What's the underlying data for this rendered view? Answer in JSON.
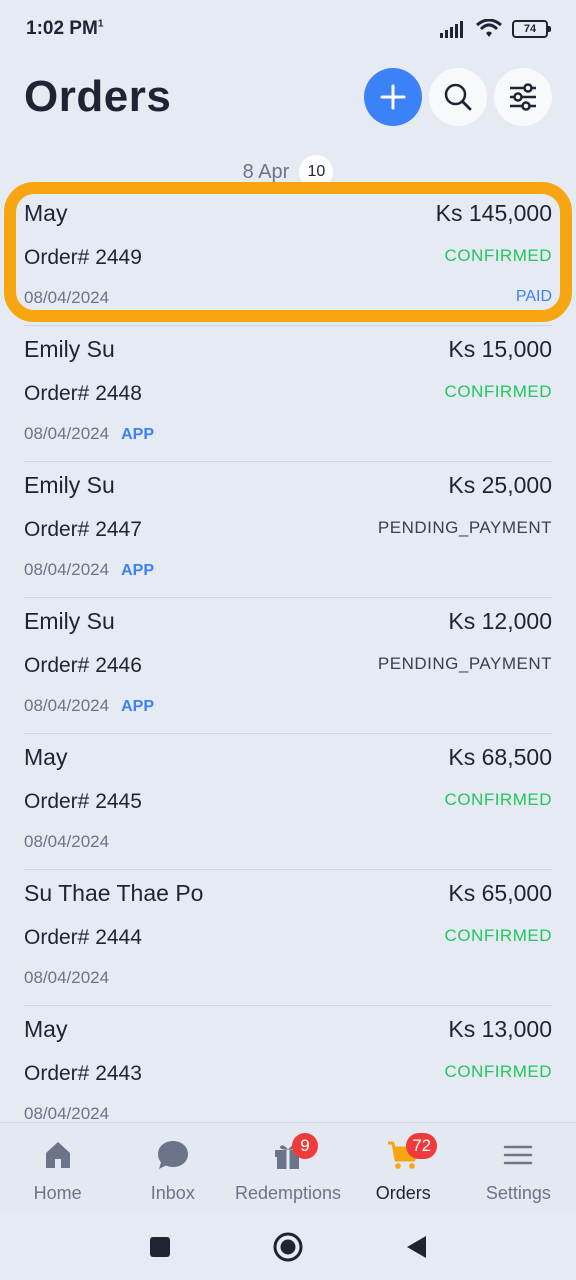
{
  "status_bar": {
    "time": "1:02 PM",
    "time_sup": "1",
    "battery": "74"
  },
  "header": {
    "title": "Orders"
  },
  "date_separator": {
    "label": "8 Apr",
    "count": "10"
  },
  "orders": [
    {
      "name": "May",
      "amount": "Ks 145,000",
      "number": "Order# 2449",
      "status": "CONFIRMED",
      "date": "08/04/2024",
      "source": "",
      "payment": "PAID"
    },
    {
      "name": "Emily Su",
      "amount": "Ks 15,000",
      "number": "Order# 2448",
      "status": "CONFIRMED",
      "date": "08/04/2024",
      "source": "APP",
      "payment": ""
    },
    {
      "name": "Emily Su",
      "amount": "Ks 25,000",
      "number": "Order# 2447",
      "status": "PENDING_PAYMENT",
      "date": "08/04/2024",
      "source": "APP",
      "payment": ""
    },
    {
      "name": "Emily Su",
      "amount": "Ks 12,000",
      "number": "Order# 2446",
      "status": "PENDING_PAYMENT",
      "date": "08/04/2024",
      "source": "APP",
      "payment": ""
    },
    {
      "name": "May",
      "amount": "Ks 68,500",
      "number": "Order# 2445",
      "status": "CONFIRMED",
      "date": "08/04/2024",
      "source": "",
      "payment": ""
    },
    {
      "name": "Su Thae Thae Po",
      "amount": "Ks 65,000",
      "number": "Order# 2444",
      "status": "CONFIRMED",
      "date": "08/04/2024",
      "source": "",
      "payment": ""
    },
    {
      "name": "May",
      "amount": "Ks 13,000",
      "number": "Order# 2443",
      "status": "CONFIRMED",
      "date": "08/04/2024",
      "source": "",
      "payment": ""
    }
  ],
  "bottom_nav": {
    "items": [
      {
        "label": "Home",
        "icon": "home-icon",
        "badge": ""
      },
      {
        "label": "Inbox",
        "icon": "chat-icon",
        "badge": ""
      },
      {
        "label": "Redemptions",
        "icon": "gift-icon",
        "badge": "9"
      },
      {
        "label": "Orders",
        "icon": "cart-icon",
        "badge": "72"
      },
      {
        "label": "Settings",
        "icon": "menu-icon",
        "badge": ""
      }
    ],
    "active": "Orders"
  },
  "colors": {
    "primary": "#3b82f6",
    "confirmed": "#22c55e",
    "highlight": "#f7a611",
    "badge": "#ef3b3b",
    "active_nav": "#f7a611"
  }
}
